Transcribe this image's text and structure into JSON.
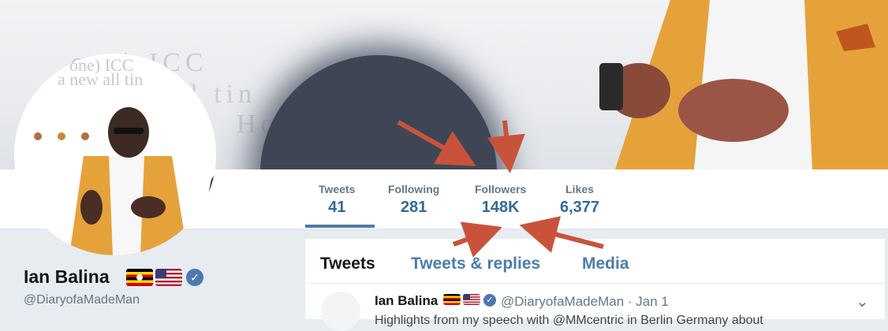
{
  "banner": {
    "faded_text_line1": "one) ICC",
    "faded_text_line2": "a new all tin",
    "faded_text_line3": "How                     ilter"
  },
  "stats": [
    {
      "label": "Tweets",
      "value": "41"
    },
    {
      "label": "Following",
      "value": "281"
    },
    {
      "label": "Followers",
      "value": "148K"
    },
    {
      "label": "Likes",
      "value": "6,377"
    }
  ],
  "profile": {
    "name": "Ian Balina",
    "handle": "@DiaryofaMadeMan"
  },
  "timeline": {
    "tabs": [
      {
        "label": "Tweets"
      },
      {
        "label": "Tweets & replies"
      },
      {
        "label": "Media"
      }
    ],
    "tweet": {
      "name": "Ian Balina",
      "handle_date": "@DiaryofaMadeMan · Jan 1",
      "body": "Highlights from my speech with @MMcentric in Berlin Germany about"
    }
  },
  "colors": {
    "link_blue": "#4b7dad",
    "stat_value": "#326a99",
    "arrow": "#c8533a",
    "verified": "#4c7ab0"
  },
  "icons": [
    "uganda-flag-icon",
    "usa-flag-icon",
    "verified-badge-icon",
    "chevron-down-icon"
  ]
}
